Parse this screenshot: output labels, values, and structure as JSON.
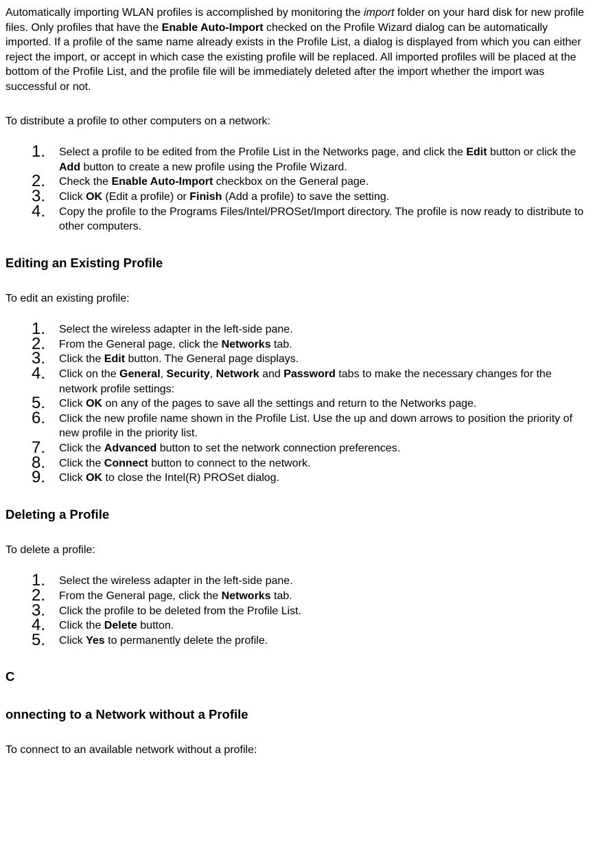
{
  "intro": {
    "seg1": "Automatically importing WLAN profiles is accomplished by monitoring the ",
    "import_italic": "import",
    "seg2": " folder on your hard disk for new profile files. Only profiles that have the ",
    "enable_auto_import": "Enable Auto-Import",
    "seg3": " checked on the Profile Wizard dialog can be automatically imported. If a profile of the same name already exists in the Profile List, a dialog is displayed from which you can either reject the import, or accept in which case the existing profile will be replaced. All imported profiles will be placed at the bottom of the Profile List, and the profile file will be immediately deleted after the import whether the import was successful or not."
  },
  "distribute_intro": "To distribute a profile to other computers on a network:",
  "distribute_list": {
    "i1_a": "Select a profile to be edited from the Profile List in the Networks page, and click the ",
    "i1_edit": "Edit",
    "i1_b": " button or click the ",
    "i1_add": "Add",
    "i1_c": " button to create a new profile using the Profile Wizard.",
    "i2_a": "Check the ",
    "i2_b": "Enable Auto-Import",
    "i2_c": " checkbox on the General page.",
    "i3_a": "Click ",
    "i3_ok": "OK",
    "i3_b": " (Edit a profile) or ",
    "i3_finish": "Finish",
    "i3_c": " (Add a profile) to save the setting.",
    "i4": "Copy the profile to the Programs Files/Intel/PROSet/Import directory. The profile is now ready to distribute to other computers."
  },
  "editing_heading": "Editing an Existing Profile",
  "editing_intro": "To edit an existing profile:",
  "editing_list": {
    "i1": "Select the wireless adapter in the left-side pane.",
    "i2_a": "From the General page, click the ",
    "i2_net": "Networks",
    "i2_b": " tab.",
    "i3_a": "Click the ",
    "i3_edit": "Edit",
    "i3_b": " button. The General page displays.",
    "i4_a": "Click on the ",
    "i4_general": "General",
    "i4_b": ", ",
    "i4_security": "Security",
    "i4_c": ", ",
    "i4_network": "Network",
    "i4_d": " and ",
    "i4_password": "Password",
    "i4_e": " tabs to make the necessary changes for the network profile settings:",
    "i5_a": "Click ",
    "i5_ok": "OK",
    "i5_b": " on any of the pages to save all the settings and return to the Networks page.",
    "i6": "Click the new profile name shown in the Profile List. Use the up and down arrows to position the priority of new profile in the priority list.",
    "i7_a": "Click the ",
    "i7_adv": "Advanced",
    "i7_b": " button to set the network connection preferences.",
    "i8_a": "Click the ",
    "i8_con": "Connect",
    "i8_b": " button to connect to the network.",
    "i9_a": "Click ",
    "i9_ok": "OK",
    "i9_b": " to close the Intel(R) PROSet dialog."
  },
  "deleting_heading": "Deleting a Profile",
  "deleting_intro": "To delete a profile:",
  "deleting_list": {
    "i1": "Select the wireless adapter in the left-side pane.",
    "i2_a": "From the General page, click the ",
    "i2_net": "Networks",
    "i2_b": " tab.",
    "i3": "Click the profile to be deleted from the Profile List.",
    "i4_a": "Click the ",
    "i4_del": "Delete",
    "i4_b": " button.",
    "i5_a": "Click ",
    "i5_yes": "Yes",
    "i5_b": " to permanently delete the profile."
  },
  "orphan_c": "C",
  "connect_heading": "onnecting to a Network without a Profile",
  "connect_intro": "To connect to an available network without a profile:"
}
